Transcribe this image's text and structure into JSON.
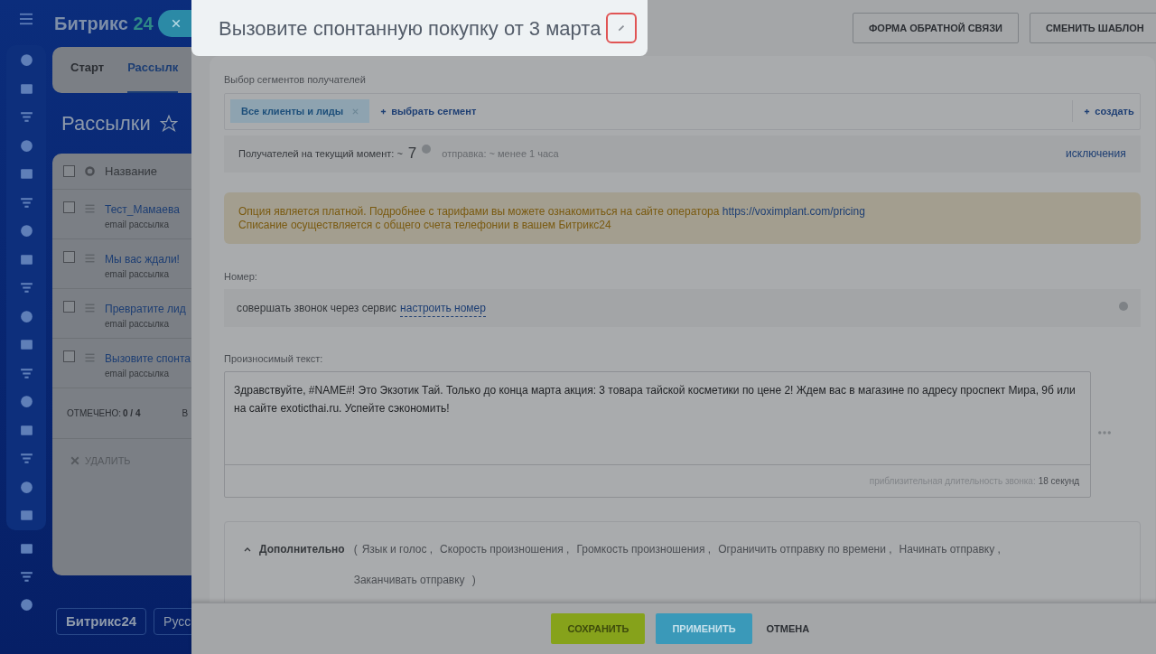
{
  "background": {
    "logo": {
      "name": "Битрикс",
      "number": "24"
    },
    "tabs": [
      {
        "label": "Старт",
        "selected": false
      },
      {
        "label": "Рассылк",
        "selected": true
      }
    ],
    "page_title": "Рассылки",
    "table": {
      "column": "Название",
      "all_checked": false,
      "rows": [
        {
          "title": "Тест_Мамаева",
          "subtitle": "email рассылка",
          "checked": false
        },
        {
          "title": "Мы вас ждали!",
          "subtitle": "email рассылка",
          "checked": false
        },
        {
          "title": "Превратите лид",
          "subtitle": "email рассылка",
          "checked": false
        },
        {
          "title": "Вызовите спонта",
          "subtitle": "email рассылка",
          "checked": false
        }
      ],
      "selected_label": "ОТМЕЧЕНО:",
      "selected_count": "0 / 4",
      "column_2_footer": "В",
      "delete": "УДАЛИТЬ"
    },
    "footer_buttons": [
      "Битрикс24",
      "Русс"
    ]
  },
  "slider": {
    "title": "Вызовите спонтанную покупку от 3 марта",
    "header_buttons": [
      "ФОРМА ОБРАТНОЙ СВЯЗИ",
      "СМЕНИТЬ ШАБЛОН"
    ],
    "segments": {
      "label": "Выбор сегментов получателей",
      "chips": [
        "Все клиенты и лиды"
      ],
      "add": "выбрать сегмент",
      "create": "создать"
    },
    "recipients": {
      "label": "Получателей на текущий момент: ~",
      "count": "7",
      "sending": "отправка: ~ менее 1 часа",
      "exclusions": "исключения"
    },
    "notice": {
      "text": "Опция является платной. Подробнее с тарифами вы можете ознакомиться на сайте оператора",
      "link": "https://voximplant.com/pricing",
      "text_2": "Списание осуществляется с общего счета телефонии в вашем Битрикс24"
    },
    "number": {
      "label": "Номер:",
      "text": "совершать звонок через сервис",
      "link": "настроить номер"
    },
    "speech": {
      "label": "Произносимый текст:",
      "value": "Здравствуйте, #NAME#! Это Экзотик Тай. Только до конца марта акция: 3 товара тайской косметики по цене 2! Ждем вас в магазине по адресу проспект Мира, 9б или на сайте exoticthai.ru. Успейте сэкономить!",
      "duration_label": "приблизительная длительность звонка:",
      "duration": "18 секунд"
    },
    "additional": {
      "label": "Дополнительно",
      "expanded": true,
      "open": "(",
      "options": [
        "Язык и голос ,",
        "Скорость произношения ,",
        "Громкость произношения ,",
        "Ограничить отправку по времени ,",
        "Начинать отправку ,",
        "Заканчивать отправку"
      ],
      "close": ")"
    },
    "buttons": [
      {
        "label": "СОХРАНИТЬ",
        "kind": "primary"
      },
      {
        "label": "ПРИМЕНИТЬ",
        "kind": "secondary"
      },
      {
        "label": "ОТМЕНА",
        "kind": "link"
      }
    ]
  }
}
